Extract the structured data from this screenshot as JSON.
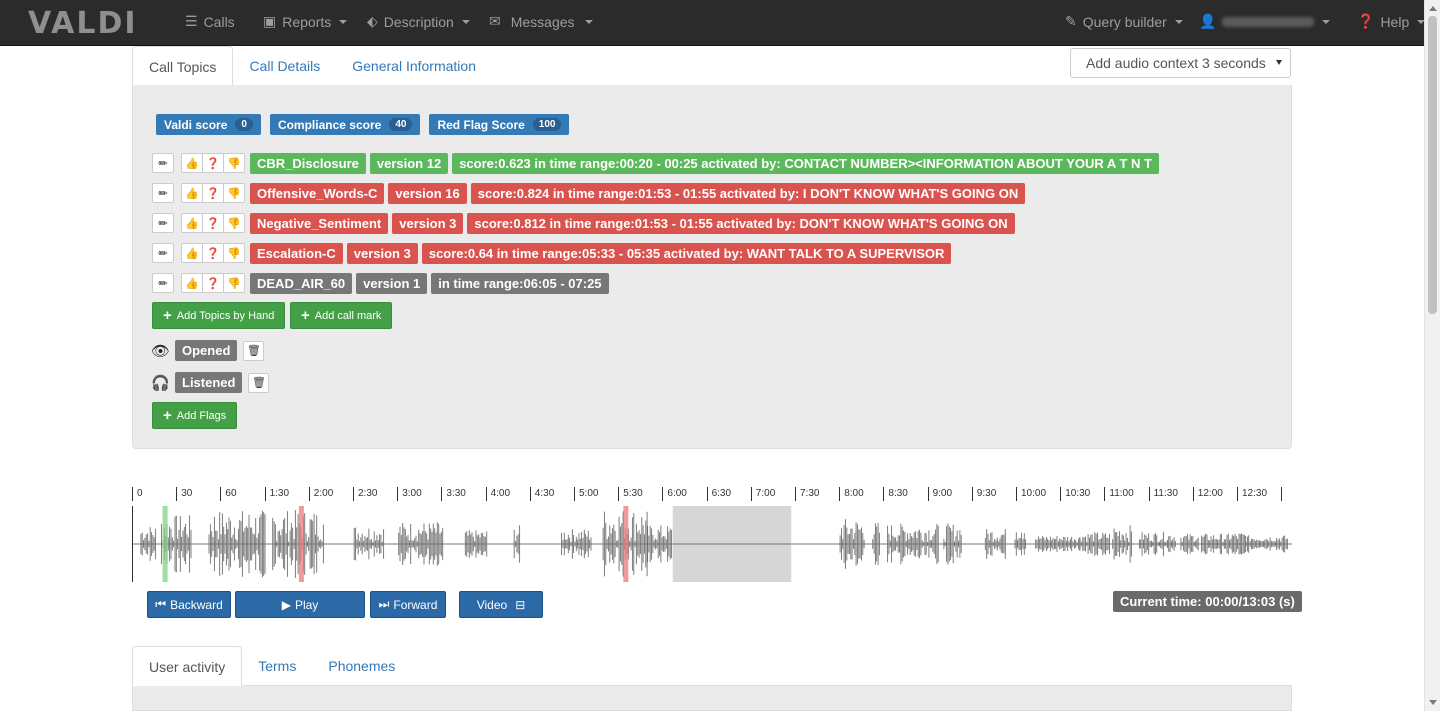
{
  "brand": "VALDI",
  "navbar": {
    "calls": "Calls",
    "reports": "Reports",
    "description": "Description",
    "messages": "Messages",
    "query_builder": "Query builder",
    "help": "Help"
  },
  "tabs_top": [
    "Call Topics",
    "Call Details",
    "General Information"
  ],
  "audio_context_select": "Add audio context 3 seconds",
  "scores": [
    {
      "label": "Valdi score",
      "count": "0"
    },
    {
      "label": "Compliance score",
      "count": "40"
    },
    {
      "label": "Red Flag Score",
      "count": "100"
    }
  ],
  "topics": [
    {
      "name": "CBR_Disclosure",
      "version": "version 12",
      "detail": "score:0.623 in time range:00:20 - 00:25 activated by: CONTACT NUMBER><INFORMATION ABOUT YOUR A T N T",
      "status_color": "#5cb85c"
    },
    {
      "name": "Offensive_Words-C",
      "version": "version 16",
      "detail": "score:0.824 in time range:01:53 - 01:55 activated by: I DON'T KNOW WHAT'S GOING ON",
      "status_color": "#d9534f"
    },
    {
      "name": "Negative_Sentiment",
      "version": "version 3",
      "detail": "score:0.812 in time range:01:53 - 01:55 activated by: DON'T KNOW WHAT'S GOING ON",
      "status_color": "#d9534f"
    },
    {
      "name": "Escalation-C",
      "version": "version 3",
      "detail": "score:0.64 in time range:05:33 - 05:35 activated by: WANT TALK TO A SUPERVISOR",
      "status_color": "#d9534f"
    },
    {
      "name": "DEAD_AIR_60",
      "version": "version 1",
      "detail": "in time range:06:05 - 07:25",
      "status_color": "#777777"
    }
  ],
  "buttons": {
    "add_topics_by_hand": "Add Topics by Hand",
    "add_call_mark": "Add call mark",
    "add_flags": "Add Flags"
  },
  "flags": [
    {
      "label": "Opened",
      "icon": "eye-icon"
    },
    {
      "label": "Listened",
      "icon": "headphones-icon"
    }
  ],
  "timeline_ticks": [
    "0",
    "30",
    "60",
    "1:30",
    "2:00",
    "2:30",
    "3:00",
    "3:30",
    "4:00",
    "4:30",
    "5:00",
    "5:30",
    "6:00",
    "6:30",
    "7:00",
    "7:30",
    "8:00",
    "8:30",
    "9:00",
    "9:30",
    "10:00",
    "10:30",
    "11:00",
    "11:30",
    "12:00",
    "12:30"
  ],
  "player": {
    "backward": "Backward",
    "play": "Play",
    "forward": "Forward",
    "video": "Video",
    "current_time": "Current time: 00:00/13:03 (s)"
  },
  "tabs_bottom": [
    "User activity",
    "Terms",
    "Phonemes"
  ],
  "audio": {
    "duration_seconds": 783,
    "dead_air_range_seconds": [
      365,
      445
    ],
    "marker_green_seconds": 22,
    "markers_red_seconds": [
      114,
      333
    ]
  }
}
